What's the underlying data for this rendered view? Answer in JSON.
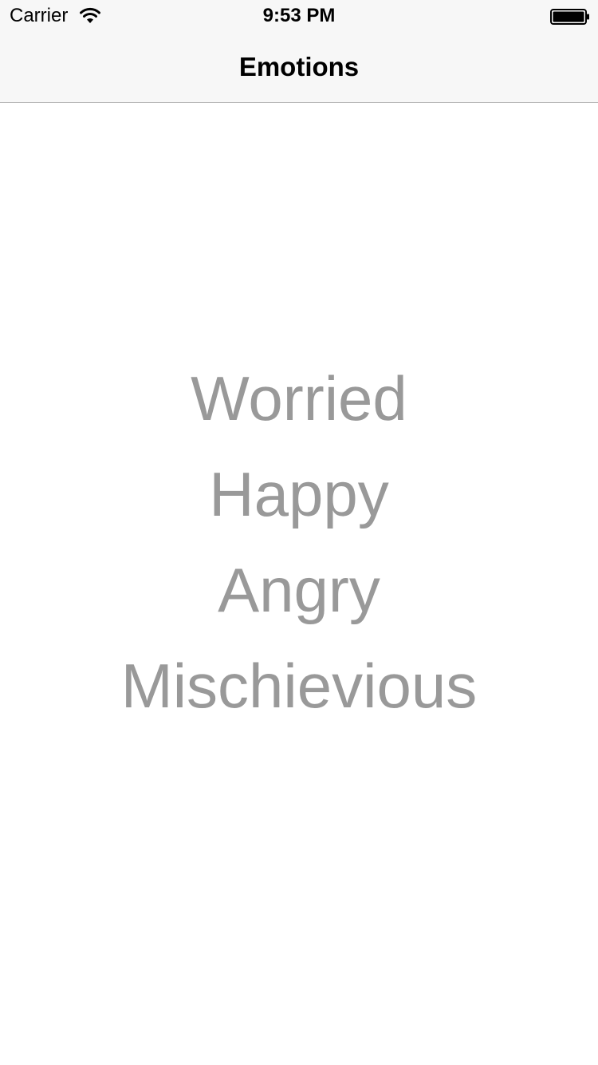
{
  "status_bar": {
    "carrier": "Carrier",
    "time": "9:53 PM",
    "wifi_icon": "wifi-icon",
    "battery_icon": "battery-icon"
  },
  "nav_bar": {
    "title": "Emotions"
  },
  "emotions": [
    {
      "label": "Worried"
    },
    {
      "label": "Happy"
    },
    {
      "label": "Angry"
    },
    {
      "label": "Mischievious"
    }
  ],
  "colors": {
    "bar_background": "#f7f7f7",
    "emotion_text": "#999999",
    "separator": "#b2b2b2"
  }
}
